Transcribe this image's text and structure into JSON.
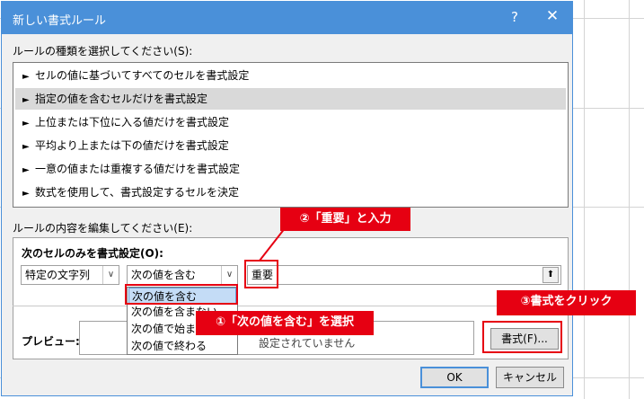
{
  "dialog": {
    "title": "新しい書式ルール",
    "help_glyph": "?",
    "close_glyph": "✕",
    "rule_type_label": "ルールの種類を選択してください(S):",
    "rule_types": [
      "セルの値に基づいてすべてのセルを書式設定",
      "指定の値を含むセルだけを書式設定",
      "上位または下位に入る値だけを書式設定",
      "平均より上または下の値だけを書式設定",
      "一意の値または重複する値だけを書式設定",
      "数式を使用して、書式設定するセルを決定"
    ],
    "selected_rule_type_index": 1,
    "edit_label": "ルールの内容を編集してください(E):",
    "only_cells_label": "次のセルのみを書式設定(O):",
    "condition_type": "特定の文字列",
    "operator": "次の値を含む",
    "value": "重要",
    "operator_options": [
      "次の値を含む",
      "次の値を含まない",
      "次の値で始まる",
      "次の値で終わる"
    ],
    "preview_label": "プレビュー:",
    "preview_text": "設定されていません",
    "format_button": "書式(F)...",
    "ok_button": "OK",
    "cancel_button": "キャンセル"
  },
  "annotations": {
    "step1": "①「次の値を含む」を選択",
    "step2": "②「重要」と入力",
    "step3": "③書式をクリック"
  },
  "colors": {
    "accent": "#4a90d9",
    "annotation_red": "#e60012",
    "dialog_bg": "#f0f0f0",
    "selection_gray": "#d9d9d9"
  },
  "icons": {
    "rule_bullet": "►",
    "combo_arrow": "∨",
    "collapse": "⬆"
  }
}
